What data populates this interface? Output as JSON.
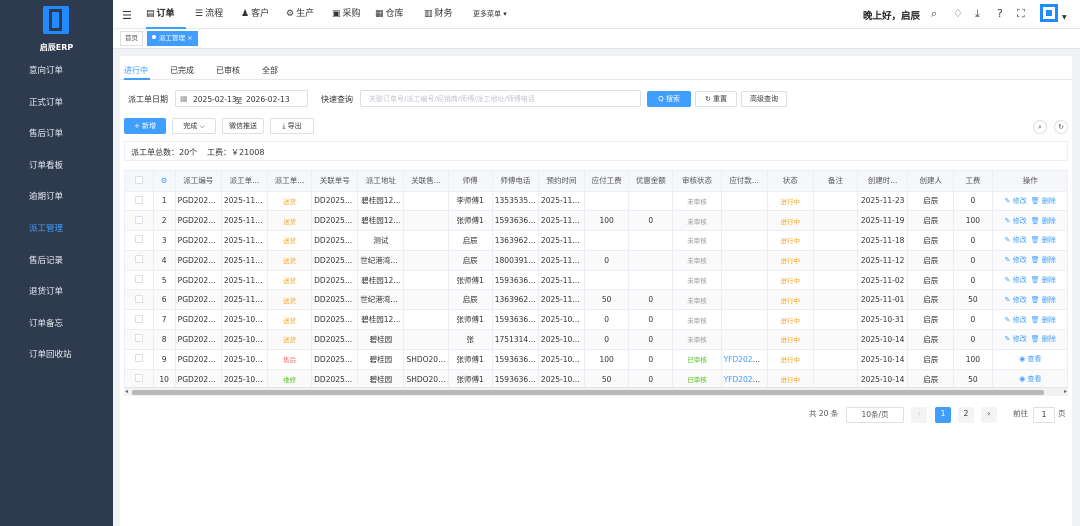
{
  "app": {
    "brand": "启辰ERP"
  },
  "sidebar": {
    "items": [
      {
        "label": "意向订单"
      },
      {
        "label": "正式订单"
      },
      {
        "label": "售后订单"
      },
      {
        "label": "订单看板"
      },
      {
        "label": "逾期订单"
      },
      {
        "label": "派工管理",
        "active": true
      },
      {
        "label": "售后记录"
      },
      {
        "label": "退货订单"
      },
      {
        "label": "订单备忘"
      },
      {
        "label": "订单回收站"
      }
    ]
  },
  "topbar": {
    "menus": [
      {
        "label": "订单",
        "icon": "order-icon",
        "active": true
      },
      {
        "label": "流程",
        "icon": "flow-icon"
      },
      {
        "label": "客户",
        "icon": "customer-icon"
      },
      {
        "label": "生产",
        "icon": "production-icon"
      },
      {
        "label": "采购",
        "icon": "purchase-icon"
      },
      {
        "label": "仓库",
        "icon": "warehouse-icon"
      },
      {
        "label": "财务",
        "icon": "finance-icon"
      },
      {
        "label": "更多菜单 ▾",
        "icon": "more-icon"
      }
    ],
    "greeting": "晚上好，启辰"
  },
  "tags": [
    {
      "label": "首页"
    },
    {
      "label": "派工管理 ×",
      "active": true
    }
  ],
  "tabs": [
    {
      "label": "进行中",
      "active": true
    },
    {
      "label": "已完成"
    },
    {
      "label": "已审核"
    },
    {
      "label": "全部"
    }
  ],
  "filters": {
    "date_label": "派工单日期",
    "date_from": "2025-02-13",
    "date_sep": "至",
    "date_to": "2026-02-13",
    "quick_label": "快速查询",
    "quick_placeholder": "关联订单号/派工编号/经销商/师傅/派工地址/师傅电话",
    "search_btn": "Q 搜索",
    "reset_btn": "↻ 重置",
    "advanced_btn": "高级查询"
  },
  "toolbar": {
    "add": "+ 新增",
    "complete": "完成 ⌵",
    "wechat": "微信推送",
    "export": "⤓ 导出"
  },
  "summary": {
    "total": "派工单总数：20个",
    "wage": "工费：￥21008"
  },
  "table": {
    "headers": [
      "",
      "⚙",
      "派工编号",
      "派工单...",
      "派工单...",
      "关联单号",
      "派工地址",
      "关联售...",
      "师傅",
      "师傅电话",
      "预约时间",
      "应付工费",
      "优惠金额",
      "审核状态",
      "应付款...",
      "状态",
      "备注",
      "创建时...",
      "创建人",
      "工费",
      "操作"
    ],
    "rows": [
      {
        "idx": "1",
        "no": "PGD2025...",
        "date": "2025-11-23",
        "type": "送货",
        "type_color": "orange",
        "order": "DD20251...",
        "addr": "碧桂园12...",
        "after": "",
        "master": "李师傅1",
        "phone": "13535353...",
        "appt": "2025-11-2...",
        "pay": "",
        "discount": "",
        "audit": "未审核",
        "audit_color": "gray",
        "payable": "",
        "status": "进行中",
        "remark": "",
        "created": "2025-11-23",
        "creator": "启辰",
        "fee": "0",
        "ops": [
          "修改",
          "删除"
        ]
      },
      {
        "idx": "2",
        "no": "PGD2025...",
        "date": "2025-11-19",
        "type": "送货",
        "type_color": "orange",
        "order": "DD20251...",
        "addr": "碧桂园12...",
        "after": "",
        "master": "张师傅1",
        "phone": "15936363...",
        "appt": "2025-11-1...",
        "pay": "100",
        "discount": "0",
        "audit": "未审核",
        "audit_color": "gray",
        "payable": "",
        "status": "进行中",
        "remark": "",
        "created": "2025-11-19",
        "creator": "启辰",
        "fee": "100",
        "ops": [
          "修改",
          "删除"
        ]
      },
      {
        "idx": "3",
        "no": "PGD2025...",
        "date": "2025-11-18",
        "type": "送货",
        "type_color": "orange",
        "order": "DD20251...",
        "addr": "测试",
        "after": "",
        "master": "启辰",
        "phone": "13639626...",
        "appt": "2025-11-1...",
        "pay": "",
        "discount": "",
        "audit": "未审核",
        "audit_color": "gray",
        "payable": "",
        "status": "进行中",
        "remark": "",
        "created": "2025-11-18",
        "creator": "启辰",
        "fee": "0",
        "ops": [
          "修改",
          "删除"
        ]
      },
      {
        "idx": "4",
        "no": "PGD2025...",
        "date": "2025-11-12",
        "type": "送货",
        "type_color": "orange",
        "order": "DD20251...",
        "addr": "世纪港湾2...",
        "after": "",
        "master": "启辰",
        "phone": "18003911...",
        "appt": "2025-11-1...",
        "pay": "0",
        "discount": "",
        "audit": "未审核",
        "audit_color": "gray",
        "payable": "",
        "status": "进行中",
        "remark": "",
        "created": "2025-11-12",
        "creator": "启辰",
        "fee": "0",
        "ops": [
          "修改",
          "删除"
        ]
      },
      {
        "idx": "5",
        "no": "PGD2025...",
        "date": "2025-11-02",
        "type": "送货",
        "type_color": "orange",
        "order": "DD20251...",
        "addr": "碧桂园12...",
        "after": "",
        "master": "张师傅1",
        "phone": "15936363...",
        "appt": "2025-11-0...",
        "pay": "",
        "discount": "",
        "audit": "未审核",
        "audit_color": "gray",
        "payable": "",
        "status": "进行中",
        "remark": "",
        "created": "2025-11-02",
        "creator": "启辰",
        "fee": "0",
        "ops": [
          "修改",
          "删除"
        ]
      },
      {
        "idx": "6",
        "no": "PGD2025...",
        "date": "2025-11-01",
        "type": "送货",
        "type_color": "orange",
        "order": "DD20251...",
        "addr": "世纪港湾2...",
        "after": "",
        "master": "启辰",
        "phone": "13639626...",
        "appt": "2025-11-0...",
        "pay": "50",
        "discount": "0",
        "audit": "未审核",
        "audit_color": "gray",
        "payable": "",
        "status": "进行中",
        "remark": "",
        "created": "2025-11-01",
        "creator": "启辰",
        "fee": "50",
        "ops": [
          "修改",
          "删除"
        ]
      },
      {
        "idx": "7",
        "no": "PGD2025...",
        "date": "2025-10-31",
        "type": "送货",
        "type_color": "orange",
        "order": "DD20251...",
        "addr": "碧桂园12...",
        "after": "",
        "master": "张师傅1",
        "phone": "15936363...",
        "appt": "2025-10-3...",
        "pay": "0",
        "discount": "0",
        "audit": "未审核",
        "audit_color": "gray",
        "payable": "",
        "status": "进行中",
        "remark": "",
        "created": "2025-10-31",
        "creator": "启辰",
        "fee": "0",
        "ops": [
          "修改",
          "删除"
        ]
      },
      {
        "idx": "8",
        "no": "PGD2025...",
        "date": "2025-10-14",
        "type": "送货",
        "type_color": "orange",
        "order": "DD20250...",
        "addr": "碧桂园",
        "after": "",
        "master": "张",
        "phone": "17513141...",
        "appt": "2025-10-1...",
        "pay": "0",
        "discount": "0",
        "audit": "未审核",
        "audit_color": "gray",
        "payable": "",
        "status": "进行中",
        "remark": "",
        "created": "2025-10-14",
        "creator": "启辰",
        "fee": "0",
        "ops": [
          "修改",
          "删除"
        ]
      },
      {
        "idx": "9",
        "no": "PGD2025...",
        "date": "2025-10-14",
        "type": "售后",
        "type_color": "red",
        "order": "DD20250...",
        "addr": "碧桂园",
        "after": "SHDO202...",
        "master": "张师傅1",
        "phone": "15936363...",
        "appt": "2025-10-1...",
        "pay": "100",
        "discount": "0",
        "audit": "已审核",
        "audit_color": "green",
        "payable": "YFD2025100...",
        "status": "进行中",
        "remark": "",
        "created": "2025-10-14",
        "creator": "启辰",
        "fee": "100",
        "ops": [
          "查看"
        ]
      },
      {
        "idx": "10",
        "no": "PGD2025...",
        "date": "2025-10-14",
        "type": "维修",
        "type_color": "green",
        "order": "DD20250...",
        "addr": "碧桂园",
        "after": "SHDO202...",
        "master": "张师傅1",
        "phone": "15936363...",
        "appt": "2025-10-1...",
        "pay": "50",
        "discount": "0",
        "audit": "已审核",
        "audit_color": "green",
        "payable": "YFD2025100...",
        "status": "进行中",
        "remark": "",
        "created": "2025-10-14",
        "creator": "启辰",
        "fee": "50",
        "ops": [
          "查看"
        ]
      }
    ]
  },
  "pagination": {
    "total": "共 20 条",
    "page_size": "10条/页",
    "prev": "‹",
    "pages": [
      "1",
      "2"
    ],
    "current": "1",
    "next": "›",
    "goto_label": "前往",
    "goto_value": "1",
    "goto_unit": "页"
  }
}
